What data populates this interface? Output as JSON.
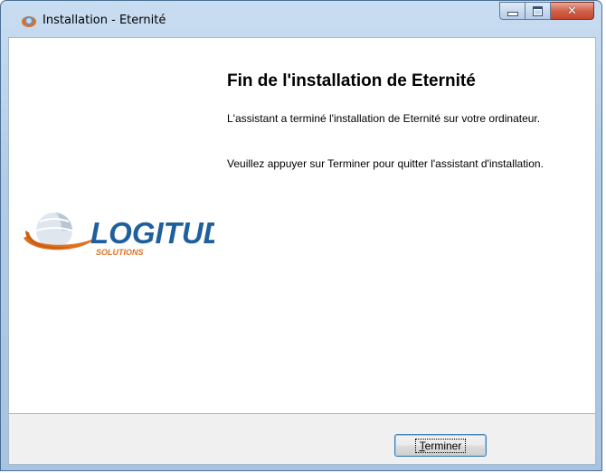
{
  "window": {
    "title": "Installation - Eternité"
  },
  "logo": {
    "name": "LOGITUD",
    "subtitle": "SOLUTIONS"
  },
  "content": {
    "heading": "Fin de l'installation de Eternité",
    "paragraph1": "L'assistant a terminé l'installation de Eternité sur votre ordinateur.",
    "paragraph2": "Veuillez appuyer sur Terminer pour quitter l'assistant d'installation."
  },
  "buttons": {
    "finish_accel": "T",
    "finish_rest": "erminer"
  },
  "colors": {
    "logo_orange": "#e0701f",
    "logo_blue": "#1f5f9c",
    "close_red": "#c4452c"
  }
}
